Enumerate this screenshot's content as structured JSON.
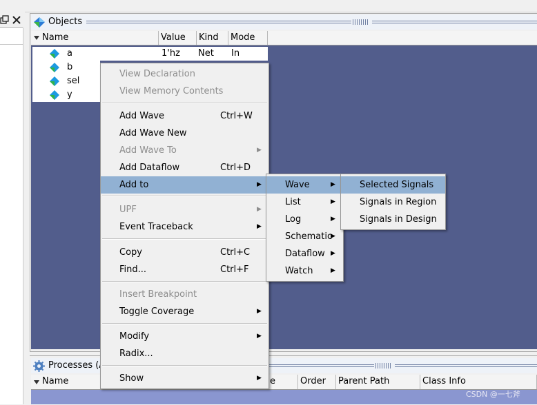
{
  "objects_panel": {
    "title": "Objects",
    "columns": [
      "Name",
      "Value",
      "Kind",
      "Mode"
    ],
    "rows": [
      {
        "name": "a",
        "value": "1'hz",
        "kind": "Net",
        "mode": "In"
      },
      {
        "name": "b",
        "value": "",
        "kind": "",
        "mode": ""
      },
      {
        "name": "sel",
        "value": "",
        "kind": "",
        "mode": ""
      },
      {
        "name": "y",
        "value": "",
        "kind": "",
        "mode": ""
      }
    ]
  },
  "processes_panel": {
    "title": "Processes (A",
    "columns": [
      "Name",
      "e",
      "Order",
      "Parent Path",
      "Class Info"
    ]
  },
  "context_menu": {
    "items": [
      {
        "label": "View Declaration",
        "disabled": true
      },
      {
        "label": "View Memory Contents",
        "disabled": true
      },
      {
        "label": "Add Wave",
        "shortcut": "Ctrl+W"
      },
      {
        "label": "Add Wave New"
      },
      {
        "label": "Add Wave To",
        "disabled": true,
        "submenu": true
      },
      {
        "label": "Add Dataflow",
        "shortcut": "Ctrl+D"
      },
      {
        "label": "Add to",
        "submenu": true,
        "highlighted": true
      },
      {
        "label": "UPF",
        "disabled": true,
        "submenu": true
      },
      {
        "label": "Event Traceback",
        "submenu": true
      },
      {
        "label": "Copy",
        "shortcut": "Ctrl+C"
      },
      {
        "label": "Find...",
        "shortcut": "Ctrl+F"
      },
      {
        "label": "Insert Breakpoint",
        "disabled": true
      },
      {
        "label": "Toggle Coverage",
        "submenu": true
      },
      {
        "label": "Modify",
        "submenu": true
      },
      {
        "label": "Radix..."
      },
      {
        "label": "Show",
        "submenu": true
      }
    ]
  },
  "submenu_add_to": {
    "items": [
      {
        "label": "Wave",
        "highlighted": true
      },
      {
        "label": "List"
      },
      {
        "label": "Log"
      },
      {
        "label": "Schematic"
      },
      {
        "label": "Dataflow"
      },
      {
        "label": "Watch"
      }
    ]
  },
  "submenu_wave": {
    "items": [
      {
        "label": "Selected Signals",
        "highlighted": true
      },
      {
        "label": "Signals in Region"
      },
      {
        "label": "Signals in Design"
      }
    ]
  },
  "watermark": "CSDN @一七斧",
  "colors": {
    "workspace": "#525d8c",
    "menu_highlight": "#91b1d3",
    "menu_bg": "#f0f0f0",
    "disabled_text": "#8d8d8d"
  },
  "icons": {
    "window_restore": "window-restore-icon",
    "window_close": "close-icon",
    "signal": "signal-diamond-icon",
    "process": "gear-icon",
    "objects": "objects-icon"
  }
}
